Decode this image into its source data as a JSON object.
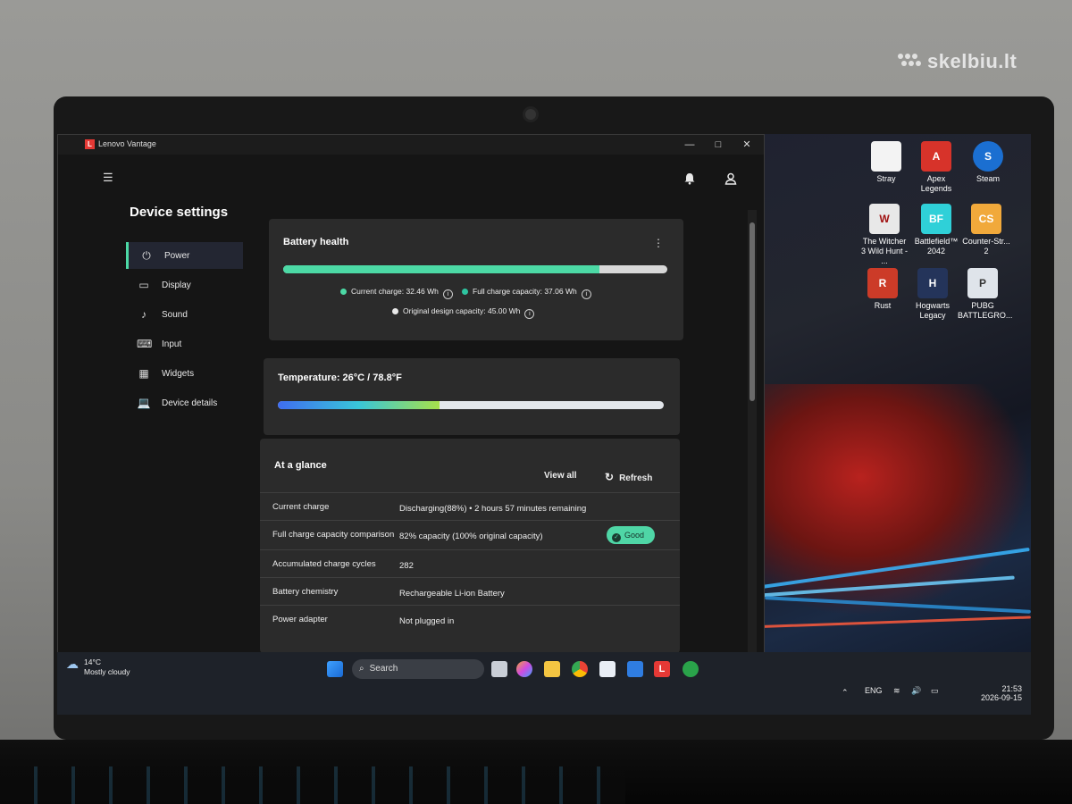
{
  "watermark": "skelbiu.lt",
  "window": {
    "title": "Lenovo Vantage",
    "minimize": "—",
    "maximize": "□",
    "close": "✕"
  },
  "header": {
    "menu_icon": "menu-icon",
    "bell_icon": "bell-icon",
    "user_icon": "user-icon"
  },
  "sidebar": {
    "heading": "Device settings",
    "items": [
      {
        "label": "Power",
        "icon": "power-plug-icon",
        "active": true
      },
      {
        "label": "Display",
        "icon": "monitor-icon"
      },
      {
        "label": "Sound",
        "icon": "music-note-icon"
      },
      {
        "label": "Input",
        "icon": "keyboard-icon"
      },
      {
        "label": "Widgets",
        "icon": "widgets-icon"
      },
      {
        "label": "Device details",
        "icon": "laptop-icon"
      }
    ]
  },
  "battery_health": {
    "title": "Battery health",
    "current_charge_label": "Current charge:",
    "current_charge_value": "32.46 Wh",
    "full_capacity_label": "Full charge capacity:",
    "full_capacity_value": "37.06 Wh",
    "design_label": "Original design capacity:",
    "design_value": "45.00 Wh",
    "bar_fraction": 0.824,
    "colors": {
      "current": "#4cd9a5",
      "full": "#2ec4a0",
      "design": "#d8d8d8"
    }
  },
  "temperature": {
    "title": "Temperature:",
    "value": "26°C / 78.8°F",
    "bar_fraction": 0.42
  },
  "glance": {
    "title": "At a glance",
    "view_all": "View all",
    "refresh": "Refresh",
    "rows": [
      {
        "label": "Current charge",
        "value": "Discharging(88%)  •  2 hours 57 minutes remaining"
      },
      {
        "label": "Full charge capacity comparison",
        "value": "82% capacity (100% original capacity)",
        "badge": "Good"
      },
      {
        "label": "Accumulated charge cycles",
        "value": "282"
      },
      {
        "label": "Battery chemistry",
        "value": "Rechargeable Li-ion Battery"
      },
      {
        "label": "Power adapter",
        "value": "Not plugged in"
      }
    ]
  },
  "desktop_icons": [
    {
      "label": "Stray",
      "color": "#f3f3f3",
      "glyph": "🐱"
    },
    {
      "label": "Apex Legends",
      "color": "#d7332a",
      "glyph": "A"
    },
    {
      "label": "Steam",
      "color": "#1b6fd1",
      "glyph": "S"
    },
    {
      "label": "The Witcher 3 Wild Hunt - ...",
      "color": "#e8e8e8",
      "glyph": "W"
    },
    {
      "label": "Battlefield™ 2042",
      "color": "#2fd0d8",
      "glyph": "BF"
    },
    {
      "label": "Counter-Str... 2",
      "color": "#f1a93b",
      "glyph": "CS"
    },
    {
      "label": "Rust",
      "color": "#cc3b28",
      "glyph": "R"
    },
    {
      "label": "Hogwarts Legacy",
      "color": "#24345a",
      "glyph": "H"
    },
    {
      "label": "PUBG BATTLEGRO...",
      "color": "#dfe4ea",
      "glyph": "P"
    }
  ],
  "taskbar": {
    "weather_temp": "14°C",
    "weather_desc": "Mostly cloudy",
    "search": "Search",
    "lang": "ENG",
    "time": "21:53",
    "date": "2026-09-15"
  }
}
